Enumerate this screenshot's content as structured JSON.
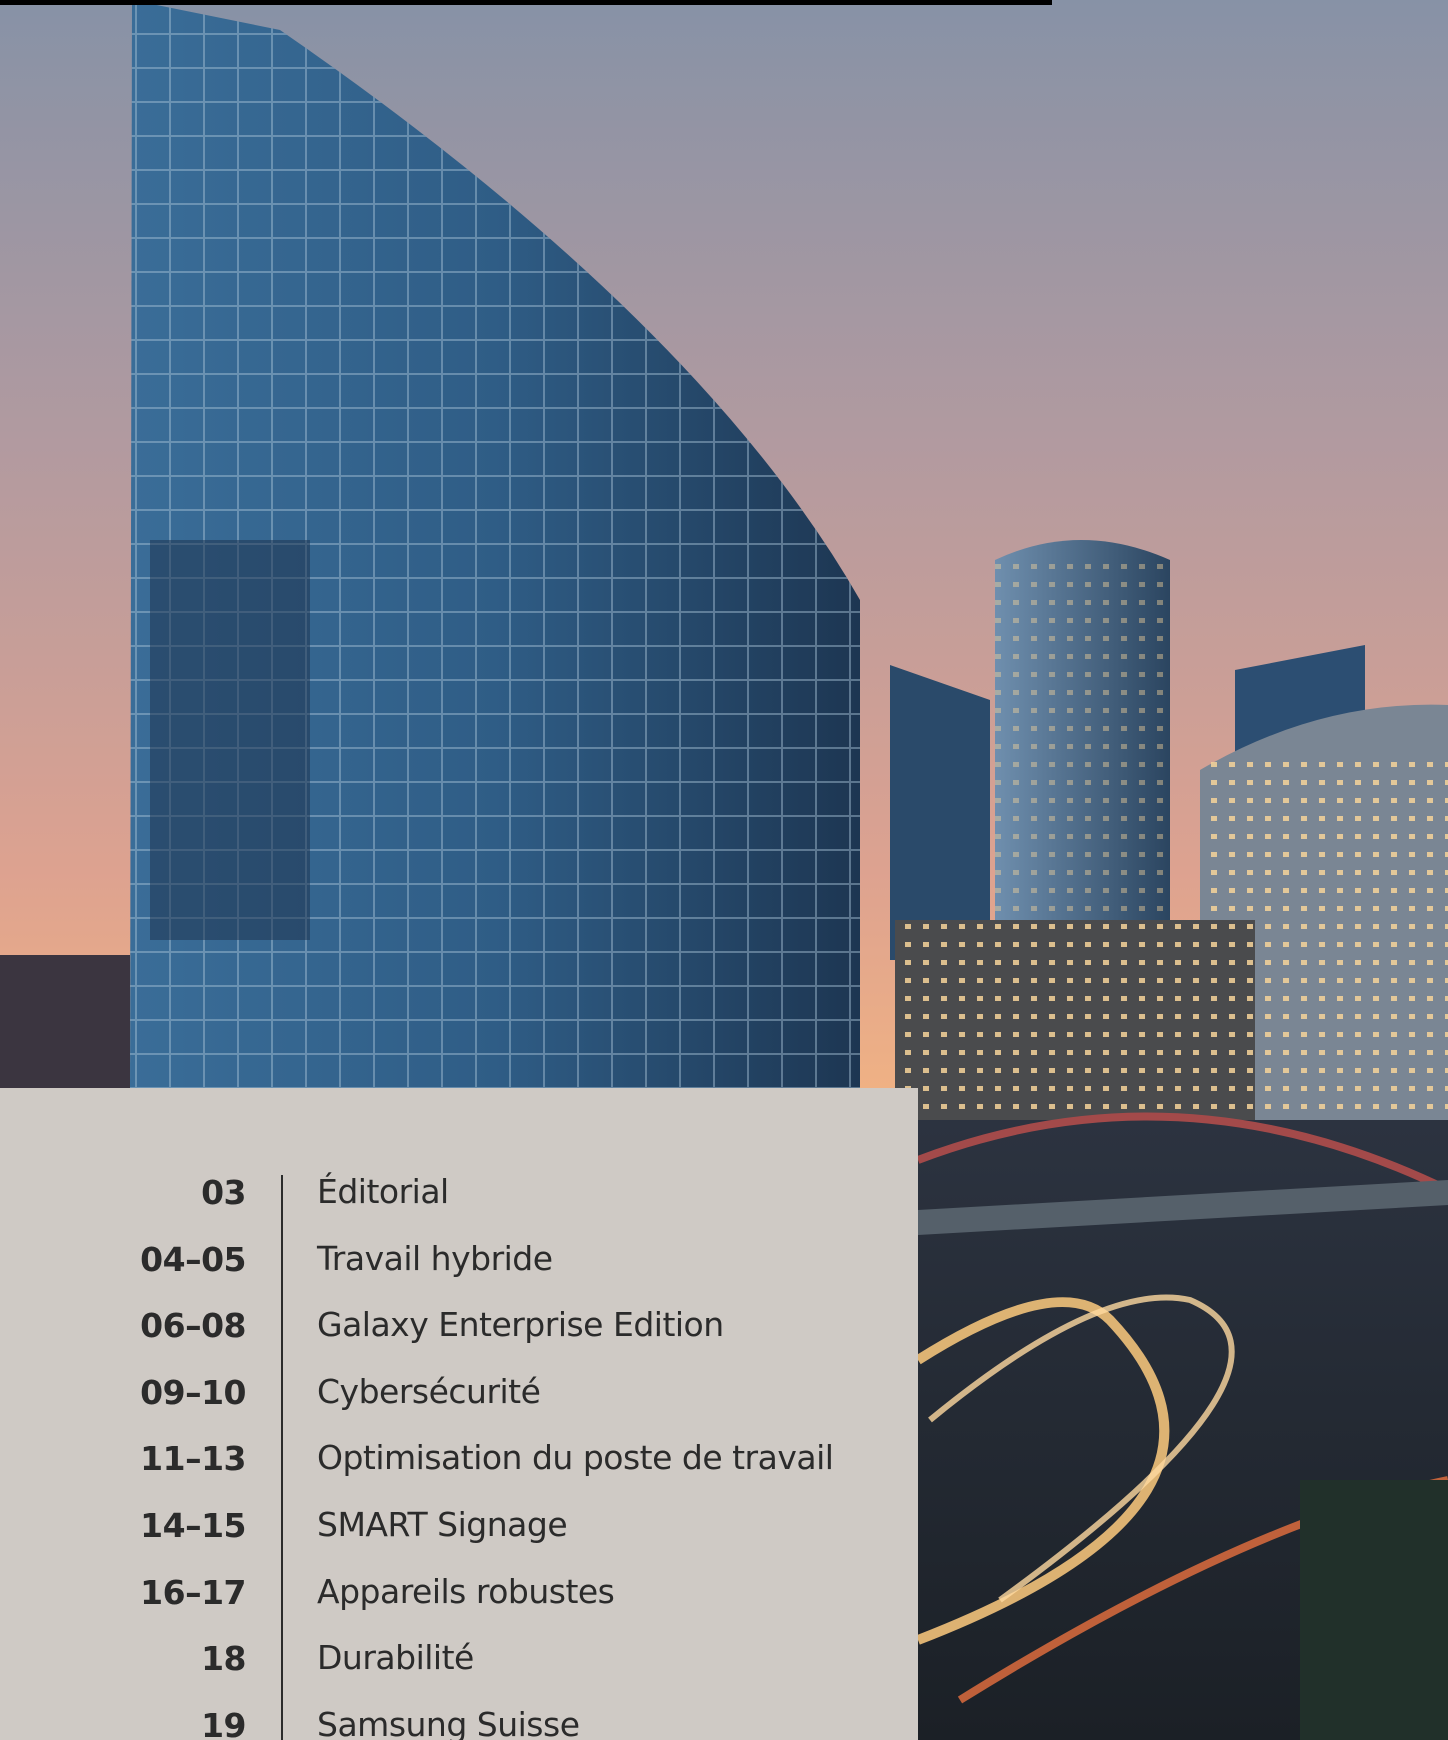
{
  "toc": {
    "items": [
      {
        "pages": "03",
        "title": "Éditorial"
      },
      {
        "pages": "04–05",
        "title": "Travail hybride"
      },
      {
        "pages": "06–08",
        "title": "Galaxy Enterprise Edition"
      },
      {
        "pages": "09–10",
        "title": "Cybersécurité"
      },
      {
        "pages": "11–13",
        "title": "Optimisation du poste de travail"
      },
      {
        "pages": "14–15",
        "title": "SMART Signage"
      },
      {
        "pages": "16–17",
        "title": "Appareils robustes"
      },
      {
        "pages": "18",
        "title": "Durabilité"
      },
      {
        "pages": "19",
        "title": "Samsung Suisse"
      }
    ]
  },
  "colors": {
    "panel": "#cfcac5",
    "text": "#2b2b2b",
    "sky_top": "#7d8aa0",
    "sky_bottom": "#f0a878",
    "glass": "#2f5d86"
  },
  "photo": {
    "subject": "cityscape-skyscrapers-photo"
  }
}
